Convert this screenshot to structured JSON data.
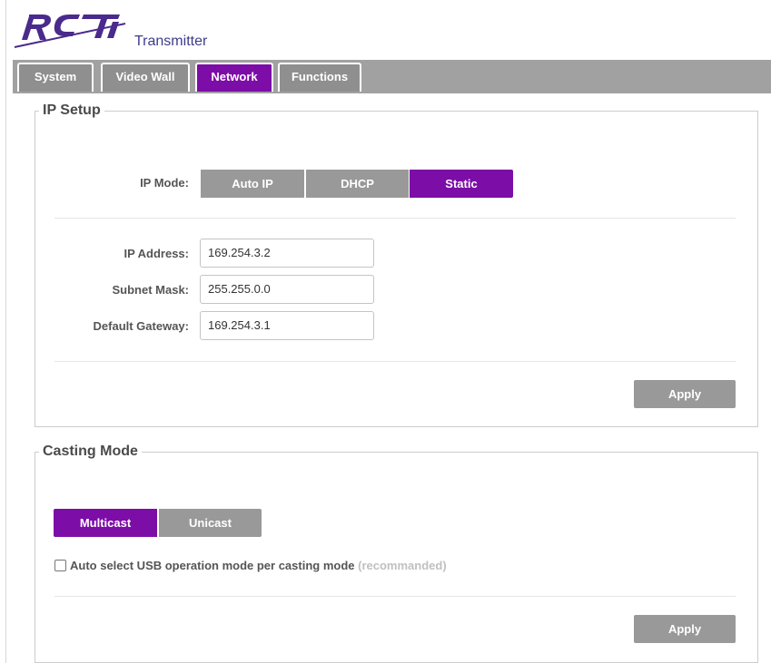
{
  "header": {
    "logo_text": "RTI",
    "subtitle": "Transmitter"
  },
  "tabs": [
    {
      "label": "System",
      "active": false
    },
    {
      "label": "Video Wall",
      "active": false
    },
    {
      "label": "Network",
      "active": true
    },
    {
      "label": "Functions",
      "active": false
    }
  ],
  "ip_setup": {
    "title": "IP Setup",
    "mode_label": "IP Mode:",
    "modes": [
      {
        "label": "Auto IP",
        "selected": false
      },
      {
        "label": "DHCP",
        "selected": false
      },
      {
        "label": "Static",
        "selected": true
      }
    ],
    "fields": [
      {
        "label": "IP Address:",
        "value": "169.254.3.2"
      },
      {
        "label": "Subnet Mask:",
        "value": "255.255.0.0"
      },
      {
        "label": "Default Gateway:",
        "value": "169.254.3.1"
      }
    ],
    "apply_label": "Apply"
  },
  "casting_mode": {
    "title": "Casting Mode",
    "modes": [
      {
        "label": "Multicast",
        "selected": true
      },
      {
        "label": "Unicast",
        "selected": false
      }
    ],
    "checkbox": {
      "checked": false,
      "label": "Auto select USB operation mode per casting mode",
      "hint": "(recommanded)"
    },
    "apply_label": "Apply"
  },
  "colors": {
    "accent": "#7c0da7",
    "button_gray": "#999999",
    "tabbar_gray": "#a1a1a1",
    "logo_purple": "#4a2a8c"
  }
}
